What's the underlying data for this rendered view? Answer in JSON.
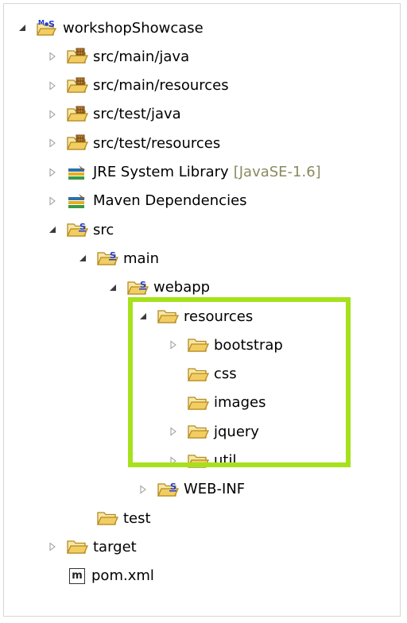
{
  "colors": {
    "highlight": "#a6e11c",
    "folder": "#f2cd62",
    "muted_text": "#8a8a5e"
  },
  "tree": [
    {
      "label": "workshopShowcase",
      "twisty": "expanded",
      "icon": "maven-project-icon",
      "depth": 0
    },
    {
      "label": "src/main/java",
      "twisty": "collapsed",
      "icon": "source-folder-icon",
      "depth": 1
    },
    {
      "label": "src/main/resources",
      "twisty": "collapsed",
      "icon": "source-folder-icon",
      "depth": 1
    },
    {
      "label": "src/test/java",
      "twisty": "collapsed",
      "icon": "source-folder-icon",
      "depth": 1
    },
    {
      "label": "src/test/resources",
      "twisty": "collapsed",
      "icon": "source-folder-icon",
      "depth": 1
    },
    {
      "label": "JRE System Library",
      "suffix": "[JavaSE-1.6]",
      "twisty": "collapsed",
      "icon": "library-icon",
      "depth": 1
    },
    {
      "label": "Maven Dependencies",
      "twisty": "collapsed",
      "icon": "library-icon",
      "depth": 1
    },
    {
      "label": "src",
      "twisty": "expanded",
      "icon": "package-folder-icon",
      "depth": 1
    },
    {
      "label": "main",
      "twisty": "expanded",
      "icon": "package-folder-icon",
      "depth": 2
    },
    {
      "label": "webapp",
      "twisty": "expanded",
      "icon": "package-folder-icon",
      "depth": 3
    },
    {
      "label": "resources",
      "twisty": "expanded",
      "icon": "folder-icon",
      "depth": 4
    },
    {
      "label": "bootstrap",
      "twisty": "collapsed",
      "icon": "folder-icon",
      "depth": 5
    },
    {
      "label": "css",
      "twisty": "none",
      "icon": "folder-icon",
      "depth": 5
    },
    {
      "label": "images",
      "twisty": "none",
      "icon": "folder-icon",
      "depth": 5
    },
    {
      "label": "jquery",
      "twisty": "collapsed",
      "icon": "folder-icon",
      "depth": 5
    },
    {
      "label": "util",
      "twisty": "collapsed",
      "icon": "folder-icon",
      "depth": 5
    },
    {
      "label": "WEB-INF",
      "twisty": "collapsed",
      "icon": "package-folder-icon",
      "depth": 4
    },
    {
      "label": "test",
      "twisty": "none",
      "icon": "folder-icon",
      "depth": 2
    },
    {
      "label": "target",
      "twisty": "collapsed",
      "icon": "folder-icon",
      "depth": 1
    },
    {
      "label": "pom.xml",
      "twisty": "none",
      "icon": "pom-file-icon",
      "depth": 1,
      "icon_text": "m"
    }
  ]
}
